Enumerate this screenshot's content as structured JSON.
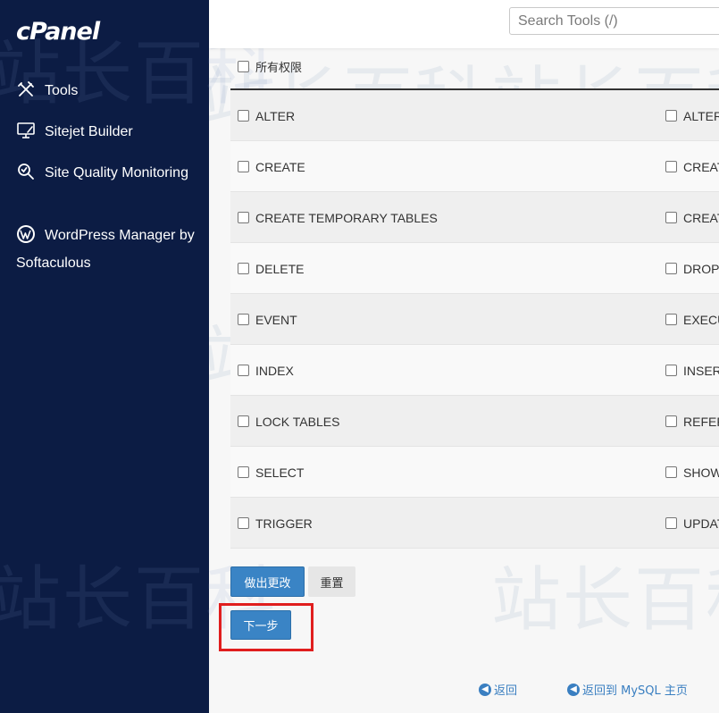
{
  "sidebar": {
    "logo": "cPanel",
    "items": [
      {
        "label": "Tools",
        "icon": "tools-icon"
      },
      {
        "label": "Sitejet Builder",
        "icon": "monitor-icon"
      },
      {
        "label": "Site Quality Monitoring",
        "icon": "magnifier-icon"
      },
      {
        "label": "WordPress Manager by Softaculous",
        "icon": "wordpress-icon"
      }
    ]
  },
  "header": {
    "search_placeholder": "Search Tools (/)"
  },
  "privileges": {
    "all_label": "所有权限",
    "rows": [
      {
        "left": "ALTER",
        "right": "ALTER"
      },
      {
        "left": "CREATE",
        "right": "CREAT"
      },
      {
        "left": "CREATE TEMPORARY TABLES",
        "right": "CREAT"
      },
      {
        "left": "DELETE",
        "right": "DROP"
      },
      {
        "left": "EVENT",
        "right": "EXECU"
      },
      {
        "left": "INDEX",
        "right": "INSERT"
      },
      {
        "left": "LOCK TABLES",
        "right": "REFER"
      },
      {
        "left": "SELECT",
        "right": "SHOW"
      },
      {
        "left": "TRIGGER",
        "right": "UPDAT"
      }
    ]
  },
  "buttons": {
    "make_changes": "做出更改",
    "reset": "重置",
    "next_step": "下一步"
  },
  "footer_links": {
    "back": "返回",
    "back_to_mysql": "返回到 MySQL 主页"
  },
  "watermark": "站长百科",
  "colors": {
    "sidebar_bg": "#0c1c44",
    "primary_button": "#3a84c5",
    "link": "#3a7fc1",
    "highlight": "#e01e1e"
  }
}
